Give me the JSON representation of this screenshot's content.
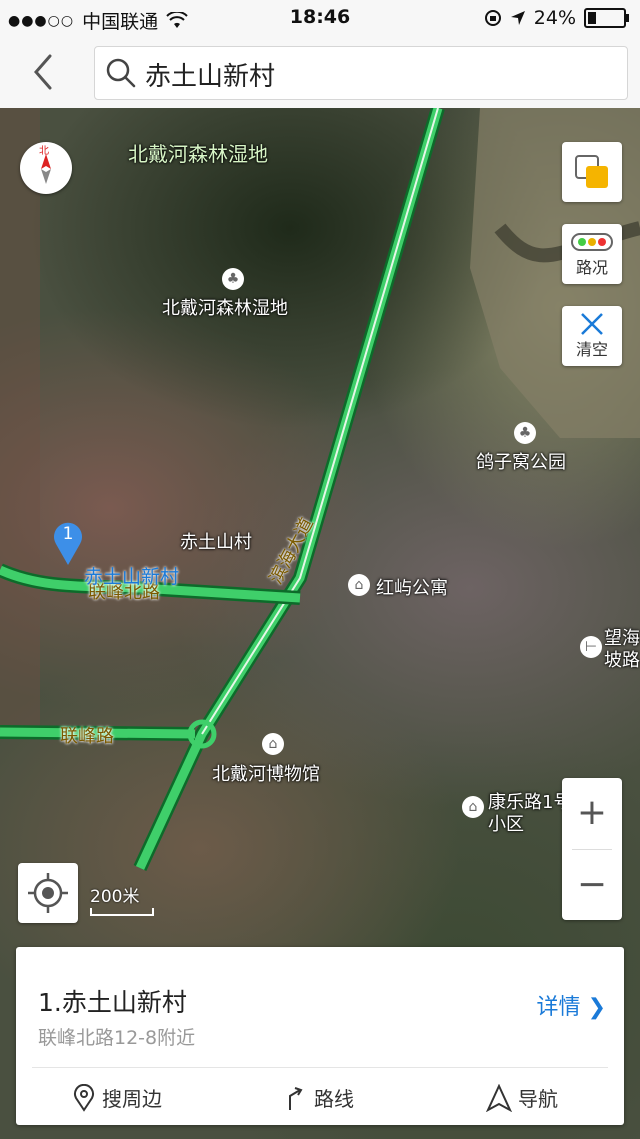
{
  "status_bar": {
    "carrier": "中国联通",
    "time": "18:46",
    "battery": "24%",
    "battery_level": 0.24
  },
  "search": {
    "query": "赤土山新村"
  },
  "map_controls": {
    "compass_label": "北",
    "layers_icon": "layers-icon",
    "traffic_label": "路况",
    "clear_label": "清空",
    "zoom_in": "+",
    "zoom_out": "−",
    "scale_label": "200米"
  },
  "map_labels": {
    "wetland_top": "北戴河森林湿地",
    "wetland_poi": "北戴河森林湿地",
    "pigeon_park": "鸽子窝公园",
    "chitushan_village": "赤土山村",
    "hongyu_apartment": "红屿公寓",
    "wanghai": "望海",
    "pobian": "坡路",
    "museum": "北戴河博物馆",
    "kangle_1": "康乐路1号",
    "kangle_2": "小区",
    "road_lianfeng_north": "联峰北路",
    "road_lianfeng": "联峰路",
    "road_binhai": "滨海大道",
    "pin_number": "1",
    "pin_label": "赤土山新村"
  },
  "result_card": {
    "title": "1.赤土山新村",
    "address": "联峰北路12-8附近",
    "detail_label": "详情",
    "actions": [
      {
        "label": "搜周边",
        "icon": "location-pin-icon"
      },
      {
        "label": "路线",
        "icon": "route-arrow-icon"
      },
      {
        "label": "导航",
        "icon": "navigation-arrow-icon"
      }
    ]
  },
  "colors": {
    "road_green": "#3fcf6a",
    "accent_blue": "#1a7ad8",
    "pin_blue": "#3d8fe8"
  }
}
